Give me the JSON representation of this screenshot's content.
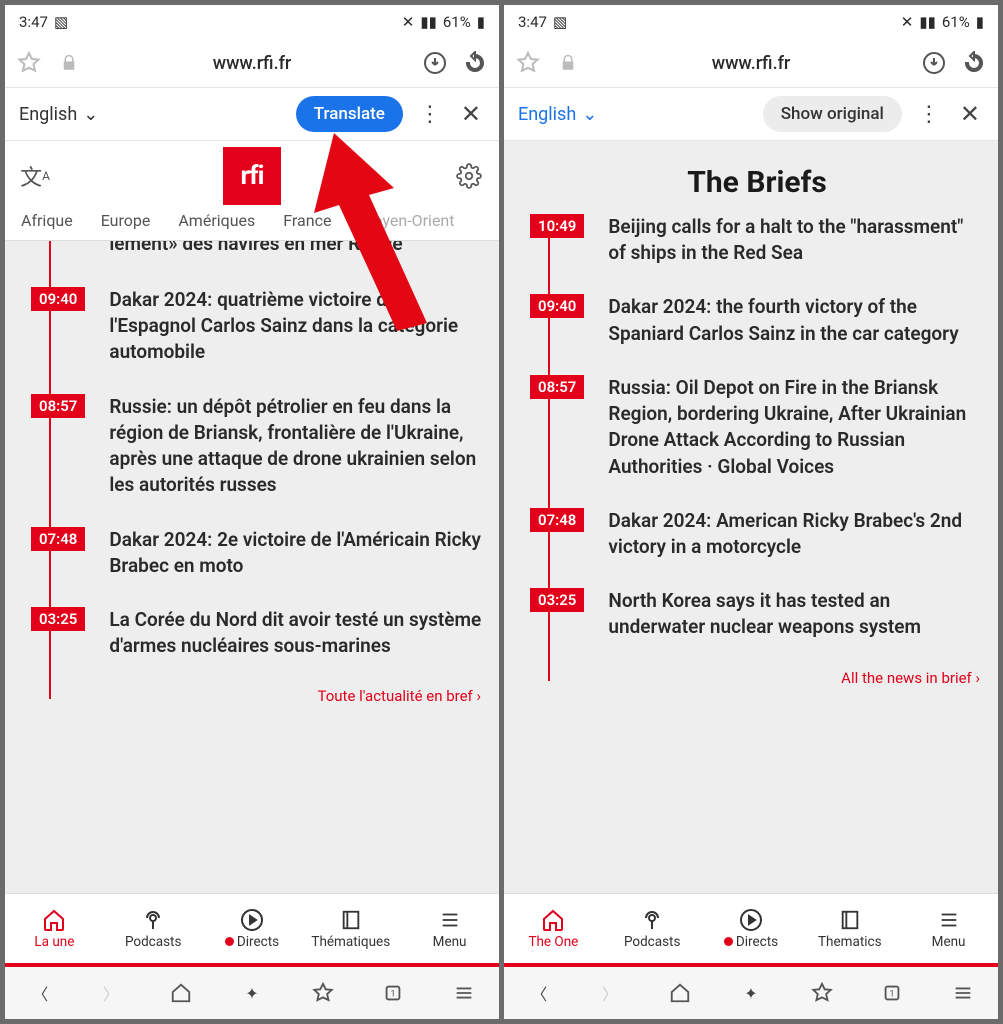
{
  "status": {
    "time": "3:47",
    "battery_pct": "61%"
  },
  "browser": {
    "url": "www.rfi.fr"
  },
  "left": {
    "translate_bar": {
      "lang": "English",
      "action": "Translate"
    },
    "site_tabs": [
      "Afrique",
      "Europe",
      "Amériques",
      "France",
      "Moyen-Orient"
    ],
    "news": [
      {
        "time": "",
        "text": "lement» des navires en mer Rouge"
      },
      {
        "time": "09:40",
        "text": "Dakar 2024: quatrième victoire de l'Espagnol Carlos Sainz dans la catégorie automobile"
      },
      {
        "time": "08:57",
        "text": "Russie: un dépôt pétrolier en feu dans la région de Briansk, frontalière de l'Ukraine, après une attaque de drone ukrainien selon les autorités russes"
      },
      {
        "time": "07:48",
        "text": "Dakar 2024: 2e victoire de l'Américain Ricky Brabec en moto"
      },
      {
        "time": "03:25",
        "text": "La Corée du Nord dit avoir testé un système d'armes nucléaires sous-marines"
      }
    ],
    "more": "Toute l'actualité en bref",
    "app_tabs": [
      "La une",
      "Podcasts",
      "Directs",
      "Thématiques",
      "Menu"
    ]
  },
  "right": {
    "translate_bar": {
      "lang": "English",
      "action": "Show original"
    },
    "section_title": "The Briefs",
    "news": [
      {
        "time": "10:49",
        "text": "Beijing calls for a halt to the \"harassment\" of ships in the Red Sea"
      },
      {
        "time": "09:40",
        "text": "Dakar 2024: the fourth victory of the Spaniard Carlos Sainz in the car category"
      },
      {
        "time": "08:57",
        "text": "Russia: Oil Depot on Fire in the Briansk Region, bordering Ukraine, After Ukrainian Drone Attack According to Russian Authorities · Global Voices"
      },
      {
        "time": "07:48",
        "text": "Dakar 2024: American Ricky Brabec's 2nd victory in a motorcycle"
      },
      {
        "time": "03:25",
        "text": "North Korea says it has tested an underwater nuclear weapons system"
      }
    ],
    "more": "All the news in brief",
    "app_tabs": [
      "The One",
      "Podcasts",
      "Directs",
      "Thematics",
      "Menu"
    ]
  }
}
